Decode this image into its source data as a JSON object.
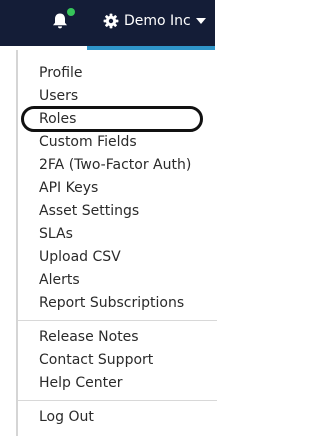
{
  "colors": {
    "topbar": "#141d37",
    "accent": "#2f95c9",
    "notification": "#36c45a",
    "menu_text": "#2a2a2a"
  },
  "header": {
    "bell_icon": "bell-icon",
    "gear_icon": "gear-icon",
    "account_label": "Demo Inc",
    "caret_icon": "caret-down-icon"
  },
  "menu": {
    "profile": "Profile",
    "users": "Users",
    "roles": "Roles",
    "custom_fields": "Custom Fields",
    "two_factor": "2FA (Two-Factor Auth)",
    "api_keys": "API Keys",
    "asset_settings": "Asset Settings",
    "slas": "SLAs",
    "upload_csv": "Upload CSV",
    "alerts": "Alerts",
    "report_subscriptions": "Report Subscriptions",
    "release_notes": "Release Notes",
    "contact_support": "Contact Support",
    "help_center": "Help Center",
    "log_out": "Log Out"
  }
}
